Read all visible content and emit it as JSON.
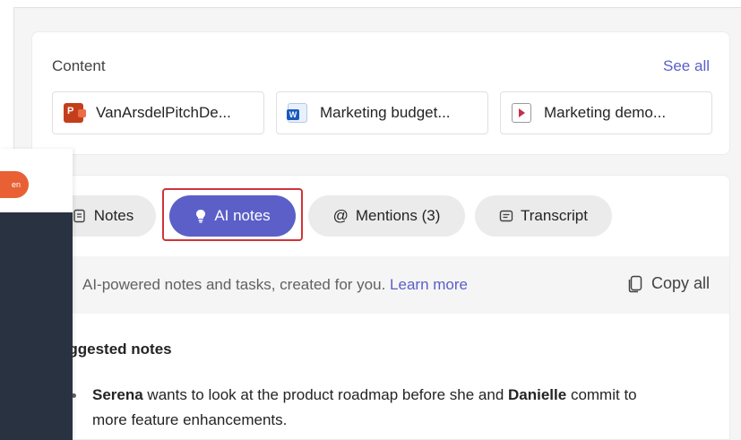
{
  "content": {
    "title": "Content",
    "see_all": "See all",
    "files": [
      {
        "name": "VanArsdelPitchDe...",
        "icon": "powerpoint-file-icon"
      },
      {
        "name": "Marketing budget...",
        "icon": "word-file-icon"
      },
      {
        "name": "Marketing demo...",
        "icon": "video-file-icon"
      }
    ]
  },
  "tabs": [
    {
      "label": "Notes",
      "icon": "notes-icon",
      "active": false
    },
    {
      "label": "AI notes",
      "icon": "lightbulb-icon",
      "active": true
    },
    {
      "label": "Mentions (3)",
      "icon": "at-icon",
      "active": false
    },
    {
      "label": "Transcript",
      "icon": "transcript-icon",
      "active": false
    }
  ],
  "info": {
    "text": "AI-powered notes and tasks, created for you.",
    "learn_more": "Learn more",
    "copy_all": "Copy all"
  },
  "suggested": {
    "title": "uggested notes",
    "item": {
      "name1": "Serena",
      "mid": " wants to look at the product roadmap before she and ",
      "name2": "Danielle",
      "end": " commit to more feature enhancements."
    }
  },
  "left_panel": {
    "button_label": "en"
  },
  "colors": {
    "accent": "#5b5fc7",
    "highlight_border": "#d13438",
    "orange": "#e86033",
    "dark_panel": "#293241"
  }
}
